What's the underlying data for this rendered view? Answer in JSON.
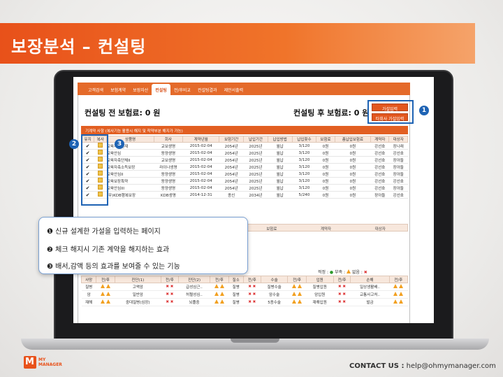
{
  "slide": {
    "title": "보장분석 – 컨설팅",
    "contact_label": "CONTACT US :",
    "contact_email": "help@ohmymanager.com",
    "logo_text_top": "MY",
    "logo_text_bottom": "MANAGER",
    "accent_color": "#e8511a",
    "highlight_color": "#1e63b4"
  },
  "app": {
    "tabs": [
      "고객검색",
      "보험계약",
      "보장자산",
      "컨설팅",
      "전/후비교",
      "컨설팅결과",
      "제안서출력"
    ],
    "active_tab": "컨설팅",
    "premium_before": "컨설팅 전 보험료: 0 원",
    "premium_after": "컨설팅 후 보험료: 0 원",
    "btn_hypothesis": "가설입력",
    "btn_hypothesis_other": "타회사 가설입력",
    "section_label": "기계약 사항 (복사기능 활용시 해지 및 착약부분 해지가 가능)",
    "columns": [
      "유지",
      "복사",
      "상품명",
      "회사",
      "계약년월",
      "보험기간",
      "납입기간",
      "납입방법",
      "납입횟수",
      "보험료",
      "총납입보험료",
      "계약자",
      "대상자"
    ],
    "contracts": [
      {
        "name": "교육자축편재",
        "company": "교보생명",
        "date": "2015-02-04",
        "term": "2054년",
        "paydate": "2025년",
        "method": "월납",
        "count": "3/120",
        "premium": "0원",
        "total": "0원",
        "holder": "강선호",
        "insured": "장나래"
      },
      {
        "name": "교육안심",
        "company": "동양생명",
        "date": "2015-02-04",
        "term": "2054년",
        "paydate": "2025년",
        "method": "월납",
        "count": "3/120",
        "premium": "0원",
        "total": "0원",
        "holder": "강선호",
        "insured": "강선호"
      },
      {
        "name": "교육자축단체II",
        "company": "교보생명",
        "date": "2015-02-04",
        "term": "2054년",
        "paydate": "2025년",
        "method": "월납",
        "count": "3/120",
        "premium": "0원",
        "total": "0원",
        "holder": "강선호",
        "insured": "장아들"
      },
      {
        "name": "교육자축소득보장",
        "company": "라이나생명",
        "date": "2015-02-04",
        "term": "2054년",
        "paydate": "2025년",
        "method": "월납",
        "count": "3/120",
        "premium": "0원",
        "total": "0원",
        "holder": "강선호",
        "insured": "장아들"
      },
      {
        "name": "교육안심II",
        "company": "동양생명",
        "date": "2015-02-04",
        "term": "2054년",
        "paydate": "2025년",
        "method": "월납",
        "count": "3/120",
        "premium": "0원",
        "total": "0원",
        "holder": "강선호",
        "insured": "장아들"
      },
      {
        "name": "교육보장특약",
        "company": "동양생명",
        "date": "2015-02-04",
        "term": "2054년",
        "paydate": "2025년",
        "method": "월납",
        "count": "3/120",
        "premium": "0원",
        "total": "0원",
        "holder": "강선호",
        "insured": "강선호"
      },
      {
        "name": "교육안심III",
        "company": "동양생명",
        "date": "2015-02-04",
        "term": "2054년",
        "paydate": "2025년",
        "method": "월납",
        "count": "3/120",
        "premium": "0원",
        "total": "0원",
        "holder": "강선호",
        "insured": "장아들"
      },
      {
        "name": "(무)KDB행복보장",
        "company": "KDB생명",
        "date": "2014-12-31",
        "term": "종신",
        "paydate": "2034년",
        "method": "월납",
        "count": "5/240",
        "premium": "0원",
        "total": "0원",
        "holder": "장아들",
        "insured": "강선호"
      }
    ],
    "lower_columns": [
      "보험기간",
      "납입기간",
      "납입방법",
      "보험료",
      "계약자",
      "대상자"
    ],
    "legend_label": "적정 : ",
    "legend_short": "부족 : ",
    "legend_none": "없음 : ",
    "coverage_columns": [
      "사망",
      "전/후",
      "진단(1)",
      "전/후",
      "진단(2)",
      "전/후",
      "질소",
      "전/후",
      "수술",
      "전/후",
      "입원",
      "전/후",
      "손해",
      "전/후"
    ],
    "coverage_rows": [
      [
        "질병",
        "",
        "고액암",
        "",
        "급성심근..",
        "",
        "질병",
        "",
        "질병수술",
        "",
        "질병입원",
        "",
        "일상생활배..",
        ""
      ],
      [
        "암",
        "",
        "일반암",
        "",
        "허혈성심..",
        "",
        "질병",
        "",
        "암수술",
        "",
        "암입원",
        "",
        "교통사고처..",
        ""
      ],
      [
        "재해",
        "",
        "중대질병(심장)",
        "",
        "뇌졸중",
        "",
        "질병",
        "",
        "5종수술",
        "",
        "재해입원",
        "",
        "벌금",
        ""
      ]
    ]
  },
  "callout": {
    "num_1": "1",
    "num_2": "2",
    "num_3": "3",
    "line_1": "❶ 신규 설계한 가설을 입력하는 페이지",
    "line_2": "❷ 체크 해지시 기존 계약을 해지하는 효과",
    "line_3": "❸ 배서,감액 등의 효과를 보여줄 수 있는 기능"
  }
}
